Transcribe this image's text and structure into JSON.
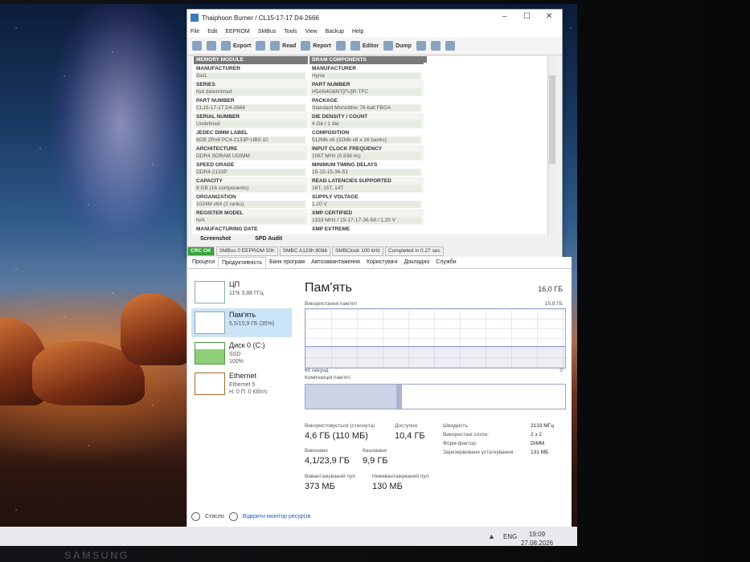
{
  "monitor": {
    "brand": "SAMSUNG"
  },
  "taskbar": {
    "lang": "ENG",
    "time": "19:09",
    "date": "27.08.2026"
  },
  "thaiphoon": {
    "title": "Thaiphoon Burner / CL15-17-17 D4-2666",
    "controls": [
      "–",
      "☐",
      "✕"
    ],
    "menu": [
      "File",
      "Edit",
      "EEPROM",
      "SMBus",
      "Tools",
      "View",
      "Backup",
      "Help"
    ],
    "toolbar": {
      "export": "Export",
      "read": "Read",
      "report": "Report",
      "editor": "Editor",
      "dump": "Dump"
    },
    "memory_header": "MEMORY MODULE",
    "dram_header": "DRAM COMPONENTS",
    "left": [
      {
        "label": "MANUFACTURER",
        "value": "GeIL"
      },
      {
        "label": "SERIES",
        "value": "Not determined"
      },
      {
        "label": "PART NUMBER",
        "value": "CL15-17-17 D4-2666"
      },
      {
        "label": "SERIAL NUMBER",
        "value": "Undefined"
      },
      {
        "label": "JEDEC DIMM LABEL",
        "value": "8GB 2Rx8 PC4-2133P-UB0-10"
      },
      {
        "label": "ARCHITECTURE",
        "value": "DDR4 SDRAM UDIMM"
      },
      {
        "label": "SPEED GRADE",
        "value": "DDR4-2133P"
      },
      {
        "label": "CAPACITY",
        "value": "8 GB (16 components)"
      },
      {
        "label": "ORGANIZATION",
        "value": "1024M x64 (2 ranks)"
      },
      {
        "label": "REGISTER MODEL",
        "value": "N/A"
      },
      {
        "label": "MANUFACTURING DATE",
        "value": ""
      }
    ],
    "right": [
      {
        "label": "MANUFACTURER",
        "value": "Hynix"
      },
      {
        "label": "PART NUMBER",
        "value": "H5AN4G8NT[FU]R-TFC"
      },
      {
        "label": "PACKAGE",
        "value": "Standard Monolithic 78-ball FBGA"
      },
      {
        "label": "DIE DENSITY / COUNT",
        "value": "4 Gb / 1 die"
      },
      {
        "label": "COMPOSITION",
        "value": "512Mb x8 (32Mb x8 x 16 banks)"
      },
      {
        "label": "INPUT CLOCK FREQUENCY",
        "value": "1067 MHz (0.938 ns)"
      },
      {
        "label": "MINIMUM TIMING DELAYS",
        "value": "15-15-15-36-51"
      },
      {
        "label": "READ LATENCIES SUPPORTED",
        "value": "16T, 15T, 14T"
      },
      {
        "label": "SUPPLY VOLTAGE",
        "value": "1.20 V"
      },
      {
        "label": "XMP CERTIFIED",
        "value": "1333 MHz / 15-17-17-36-58 / 1.20 V"
      },
      {
        "label": "XMP EXTREME",
        "value": ""
      }
    ],
    "tabs": [
      "Screenshot",
      "SPD Audit"
    ],
    "status": [
      "CRC OK",
      "SMBus 0 EEPROM 50h",
      "SMBC A123h:8086",
      "SMBClock 100 kHz",
      "Completed in 0.27 sec"
    ]
  },
  "taskmgr": {
    "tabs": [
      "Процеси",
      "Продуктивність",
      "Банк програм",
      "Автозавантаження",
      "Користувачі",
      "Докладно",
      "Служби"
    ],
    "active_tab": "Продуктивність",
    "sidebar": [
      {
        "title": "ЦП",
        "sub1": "11% 3,88 ГГц",
        "sub2": ""
      },
      {
        "title": "Пам'ять",
        "sub1": "5,5/15,9 ГБ (35%)",
        "sub2": ""
      },
      {
        "title": "Диск 0 (C:)",
        "sub1": "SSD",
        "sub2": "100%"
      },
      {
        "title": "Ethernet",
        "sub1": "Ethernet 5",
        "sub2": "Н: 0 П: 0 Кбіт/с"
      }
    ],
    "main": {
      "title": "Пам'ять",
      "total": "16,0 ГБ",
      "usage_label": "Використання пам'яті",
      "usage_max": "15,9 ГБ",
      "graph_left": "60 секунд",
      "graph_right": "0",
      "composition_label": "Композиція пам'яті",
      "usage_fraction": 0.35
    },
    "stats": {
      "in_use_label": "Використовується (стиснута)",
      "in_use": "4,6 ГБ (110 МБ)",
      "available_label": "Доступно",
      "available": "10,4 ГБ",
      "committed_label": "Виконано",
      "committed": "4,1/23,9 ГБ",
      "cached_label": "Кешовано",
      "cached": "9,9 ГБ",
      "paged_label": "Вивантажуваний пул",
      "paged": "373 МБ",
      "nonpaged_label": "Невивантажуваний пул",
      "nonpaged": "130 МБ"
    },
    "props": [
      {
        "label": "Швидкість:",
        "value": "2133 МГц"
      },
      {
        "label": "Використані слоти:",
        "value": "2 з 2"
      },
      {
        "label": "Форм-фактор:",
        "value": "DIMM"
      },
      {
        "label": "Зарезервоване устаткування:",
        "value": "131 МБ"
      }
    ],
    "footer": {
      "less": "Стисло",
      "open": "Відкрити монітор ресурсів"
    }
  }
}
